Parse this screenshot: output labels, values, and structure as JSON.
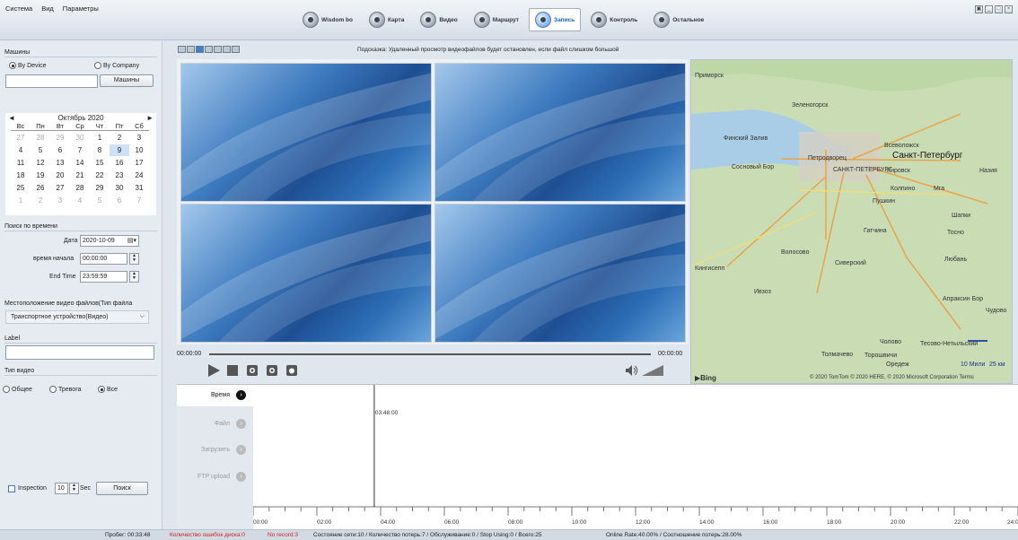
{
  "menu": [
    "Система",
    "Вид",
    "Параметры"
  ],
  "nav": [
    {
      "label": "Wisdom bo",
      "icon": "wisdom-icon"
    },
    {
      "label": "Карта",
      "icon": "map-icon"
    },
    {
      "label": "Видео",
      "icon": "video-icon"
    },
    {
      "label": "Маршрут",
      "icon": "route-icon"
    },
    {
      "label": "Запись",
      "icon": "record-icon",
      "active": true
    },
    {
      "label": "Контроль",
      "icon": "control-icon"
    },
    {
      "label": "Остальное",
      "icon": "other-icon"
    }
  ],
  "left": {
    "machines_title": "Машины",
    "by_device": "By Device",
    "by_company": "By Company",
    "machines_btn": "Машины",
    "calendar": {
      "month": "Октябрь 2020",
      "weekdays": [
        "Вс",
        "Пн",
        "Вт",
        "Ср",
        "Чт",
        "Пт",
        "Сб"
      ],
      "days": [
        [
          "27",
          "28",
          "29",
          "30",
          "1",
          "2",
          "3"
        ],
        [
          "4",
          "5",
          "6",
          "7",
          "8",
          "9",
          "10"
        ],
        [
          "11",
          "12",
          "13",
          "14",
          "15",
          "16",
          "17"
        ],
        [
          "18",
          "19",
          "20",
          "21",
          "22",
          "23",
          "24"
        ],
        [
          "25",
          "26",
          "27",
          "28",
          "29",
          "30",
          "31"
        ],
        [
          "1",
          "2",
          "3",
          "4",
          "5",
          "6",
          "7"
        ]
      ]
    },
    "time_search": "Поиск по времени",
    "date_label": "Дата",
    "date_value": "2020-10-09",
    "start_label": "время начала",
    "start_value": "00:00:00",
    "end_label": "End Time",
    "end_value": "23:59:59",
    "location_label": "Местоположение видео файлов(Тип файла",
    "location_value": "Транспортное устройство(Видео)",
    "label_title": "Label",
    "video_type": "Тип видео",
    "vt_general": "Общее",
    "vt_alarm": "Тревога",
    "vt_all": "Все",
    "inspection": "Inspection",
    "inspection_value": "10",
    "sec": "Sec",
    "search_btn": "Поиск"
  },
  "hint": "Подсказка: Удаленный просмотр видеофайлов будет остановлен, если файл слишком большой",
  "player": {
    "time_start": "00:00:00",
    "time_end": "00:00:00"
  },
  "map": {
    "labels": [
      {
        "text": "Приморск"
      },
      {
        "text": "Зеленогорск"
      },
      {
        "text": "Финский Залив"
      },
      {
        "text": "Всеволожск"
      },
      {
        "text": "Петродворец"
      },
      {
        "text": "Санкт-Петербург"
      },
      {
        "text": "Сосновый Бор"
      },
      {
        "text": "САНКТ-ПЕТЕРБУРГ"
      },
      {
        "text": "Кировск"
      },
      {
        "text": "Назия"
      },
      {
        "text": "Колпино"
      },
      {
        "text": "Мга"
      },
      {
        "text": "Пушкин"
      },
      {
        "text": "Шапки"
      },
      {
        "text": "Гатчина"
      },
      {
        "text": "Тосно"
      },
      {
        "text": "Волосово"
      },
      {
        "text": "Кингисепп"
      },
      {
        "text": "Сиверский"
      },
      {
        "text": "Любань"
      },
      {
        "text": "Ивзоз"
      },
      {
        "text": "Апраксин Бор"
      },
      {
        "text": "Чудово"
      },
      {
        "text": "Чолово"
      },
      {
        "text": "Тесово-Нетыльский"
      },
      {
        "text": "Толмачево"
      },
      {
        "text": "Торошвичи"
      },
      {
        "text": "Оредеж"
      }
    ],
    "scale_mi": "10 Мили",
    "scale_km": "25 км",
    "bing": "Bing",
    "copyright": "© 2020 TomTom © 2020 HERE, © 2020 Microsoft Corporation Terms"
  },
  "tabs": [
    {
      "label": "Время",
      "active": true
    },
    {
      "label": "Файл"
    },
    {
      "label": "Загрузить"
    },
    {
      "label": "FTP upload"
    }
  ],
  "timeline": {
    "cursor_label": "03:48:00",
    "cursor_hour": 3.8,
    "ticks": [
      "00:00",
      "02:00",
      "04:00",
      "06:00",
      "08:00",
      "10:00",
      "12:00",
      "14:00",
      "16:00",
      "18:00",
      "20:00",
      "22:00",
      "24:00"
    ]
  },
  "status": {
    "mileage": "Пробег: 00:33:48",
    "disk_errors": "Количество ошибок диска:0",
    "no_record": "No record:3",
    "net": "Состояние сети:10 / Количество потерь:7 / Обслуживание:0 / Stop Using:0 / Всего:25",
    "online": "Online Rate:40.00% / Соотношение потерь:28.00%"
  },
  "colors": {
    "accent": "#1a62c8",
    "error": "#d22020"
  }
}
